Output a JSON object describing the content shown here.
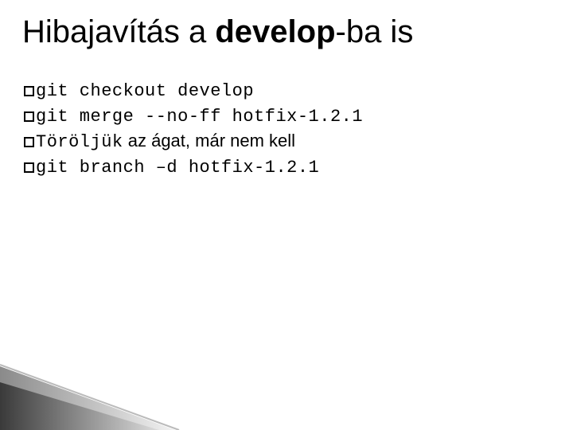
{
  "title": {
    "part1": "Hibajavítás a ",
    "part2_bold": "develop",
    "part3": "-ba is"
  },
  "lines": {
    "l1": "git checkout develop",
    "l2": "git merge --no-ff hotfix-1.2.1",
    "l3_a": "Töröljük",
    "l3_b": " az ágat, már nem kell",
    "l4": "git branch –d hotfix-1.2.1"
  }
}
